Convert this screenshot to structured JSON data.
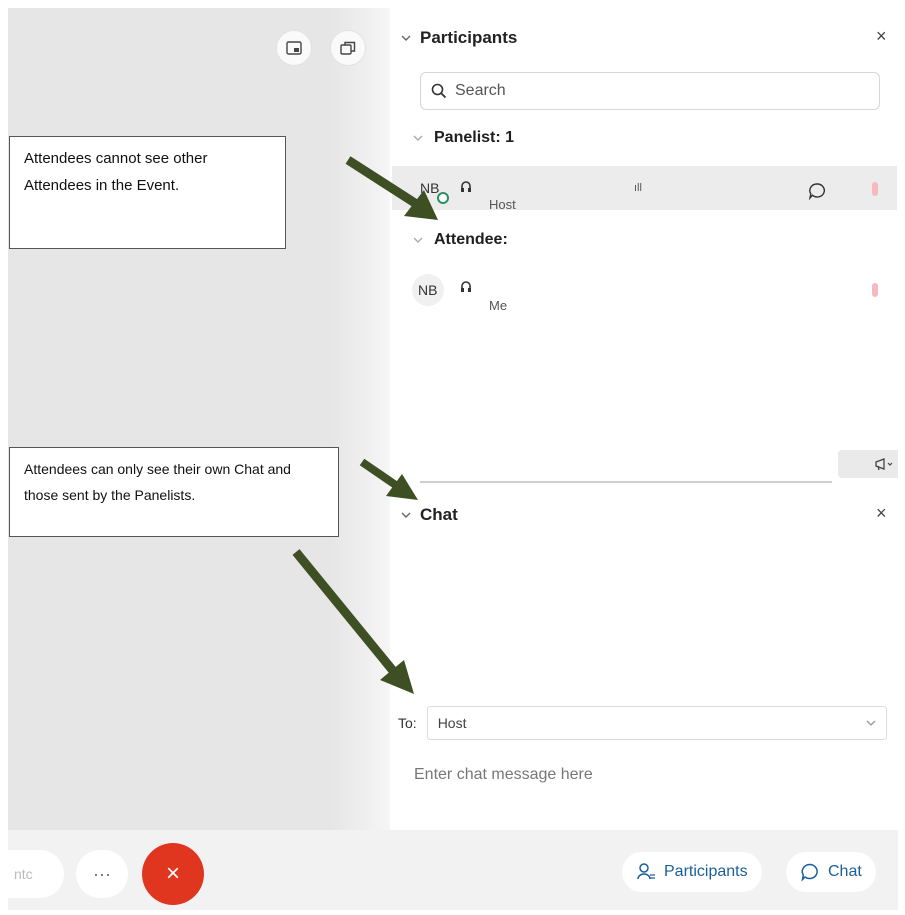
{
  "participants": {
    "title": "Participants",
    "search_placeholder": "Search",
    "panelist_group": "Panelist: 1",
    "attendee_group": "Attendee:",
    "panelist_row": {
      "initials": "NB",
      "bars": "ıll",
      "role": "Host"
    },
    "attendee_row": {
      "initials": "NB",
      "role": "Me"
    }
  },
  "chat": {
    "title": "Chat",
    "to_label": "To:",
    "to_value": "Host",
    "input_placeholder": "Enter chat message here"
  },
  "toolbar": {
    "faded_label": "ntc",
    "more_label": "···",
    "end_label": "×",
    "participants_label": "Participants",
    "chat_label": "Chat"
  },
  "callouts": {
    "attendees_visibility": "Attendees cannot see other Attendees in the Event.",
    "chat_visibility": "Attendees can only see their own Chat and those sent by the Panelists."
  },
  "colors": {
    "end_call": "#e0361f",
    "accent": "#1b5f9a",
    "arrow": "#3d4f23",
    "mic": "#f6b9c1"
  }
}
